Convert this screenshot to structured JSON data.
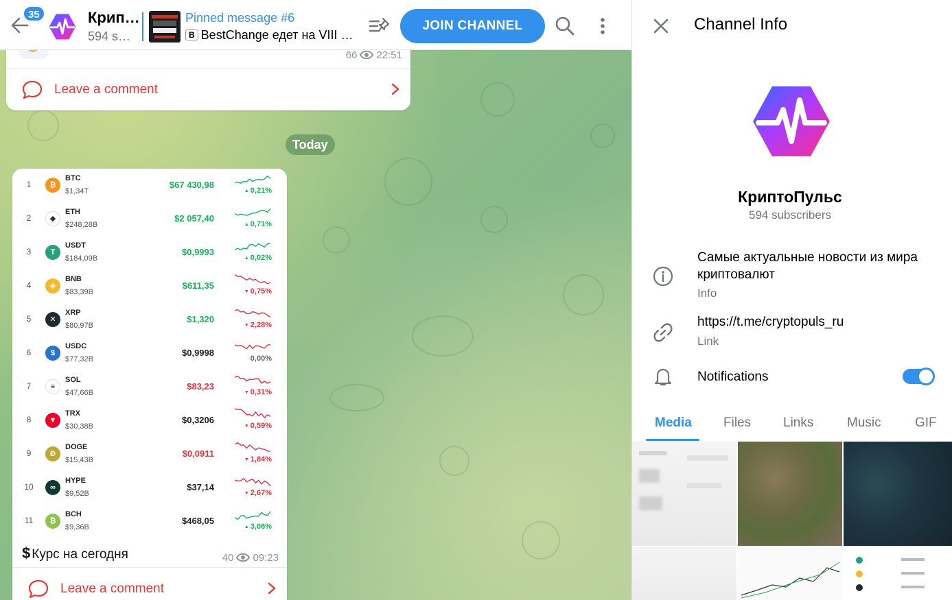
{
  "header": {
    "unread_count": "35",
    "title": "КриптоПульс",
    "subtitle": "594 subscribers",
    "pinned_title": "Pinned message #6",
    "pinned_icon_letter": "B",
    "pinned_text": "BestChange едет на VIII Евразийский форум",
    "join_label": "JOIN CHANNEL"
  },
  "messages": {
    "first": {
      "views": "66",
      "time": "22:51",
      "comment_label": "Leave a comment"
    },
    "date_separator": "Today",
    "second": {
      "caption_icon": "$",
      "caption": "Курс на сегодня",
      "views": "40",
      "time": "09:23",
      "comment_label": "Leave a comment",
      "coins": [
        {
          "rank": "1",
          "symbol": "BTC",
          "cap": "$1,34T",
          "price": "$67 430,98",
          "change": "0,21%",
          "dir": "up",
          "logo_color": "#f7931a",
          "logo_char": "₿"
        },
        {
          "rank": "2",
          "symbol": "ETH",
          "cap": "$248,28B",
          "price": "$2 057,40",
          "change": "0,71%",
          "dir": "up",
          "logo_color": "#ffffff",
          "logo_char": "◆"
        },
        {
          "rank": "3",
          "symbol": "USDT",
          "cap": "$184,09B",
          "price": "$0,9993",
          "change": "0,02%",
          "dir": "up",
          "logo_color": "#26a17b",
          "logo_char": "T"
        },
        {
          "rank": "4",
          "symbol": "BNB",
          "cap": "$83,39B",
          "price": "$611,35",
          "change": "0,75%",
          "dir": "down",
          "logo_color": "#f3ba2f",
          "logo_char": "◈"
        },
        {
          "rank": "5",
          "symbol": "XRP",
          "cap": "$80,97B",
          "price": "$1,320",
          "change": "2,28%",
          "dir": "down",
          "logo_color": "#23292f",
          "logo_char": "✕"
        },
        {
          "rank": "6",
          "symbol": "USDC",
          "cap": "$77,32B",
          "price": "$0,9998",
          "change": "0,00%",
          "dir": "flat",
          "logo_color": "#2775ca",
          "logo_char": "$"
        },
        {
          "rank": "7",
          "symbol": "SOL",
          "cap": "$47,66B",
          "price": "$83,23",
          "change": "0,31%",
          "dir": "down",
          "logo_color": "#ffffff",
          "logo_char": "≡"
        },
        {
          "rank": "8",
          "symbol": "TRX",
          "cap": "$30,38B",
          "price": "$0,3206",
          "change": "0,59%",
          "dir": "down",
          "logo_color": "#ef0027",
          "logo_char": "▼"
        },
        {
          "rank": "9",
          "symbol": "DOGE",
          "cap": "$15,43B",
          "price": "$0,0911",
          "change": "1,84%",
          "dir": "down",
          "logo_color": "#c2a633",
          "logo_char": "Ð"
        },
        {
          "rank": "10",
          "symbol": "HYPE",
          "cap": "$9,52B",
          "price": "$37,14",
          "change": "2,67%",
          "dir": "down",
          "logo_color": "#0f3933",
          "logo_char": "∞"
        },
        {
          "rank": "11",
          "symbol": "BCH",
          "cap": "$9,36B",
          "price": "$468,05",
          "change": "3,06%",
          "dir": "up",
          "logo_color": "#8dc351",
          "logo_char": "₿"
        }
      ]
    }
  },
  "info_panel": {
    "title": "Channel Info",
    "name": "КриптоПульс",
    "subscribers": "594 subscribers",
    "description": "Самые актуальные новости из мира криптовалют",
    "description_label": "Info",
    "link": "https://t.me/cryptopuls_ru",
    "link_label": "Link",
    "notifications_label": "Notifications",
    "notifications_on": true,
    "tabs": [
      "Media",
      "Files",
      "Links",
      "Music",
      "GIF"
    ],
    "active_tab": "Media"
  },
  "colors": {
    "accent": "#3390ec",
    "up": "#16b35a",
    "down": "#e5323f",
    "comment": "#e53935"
  }
}
